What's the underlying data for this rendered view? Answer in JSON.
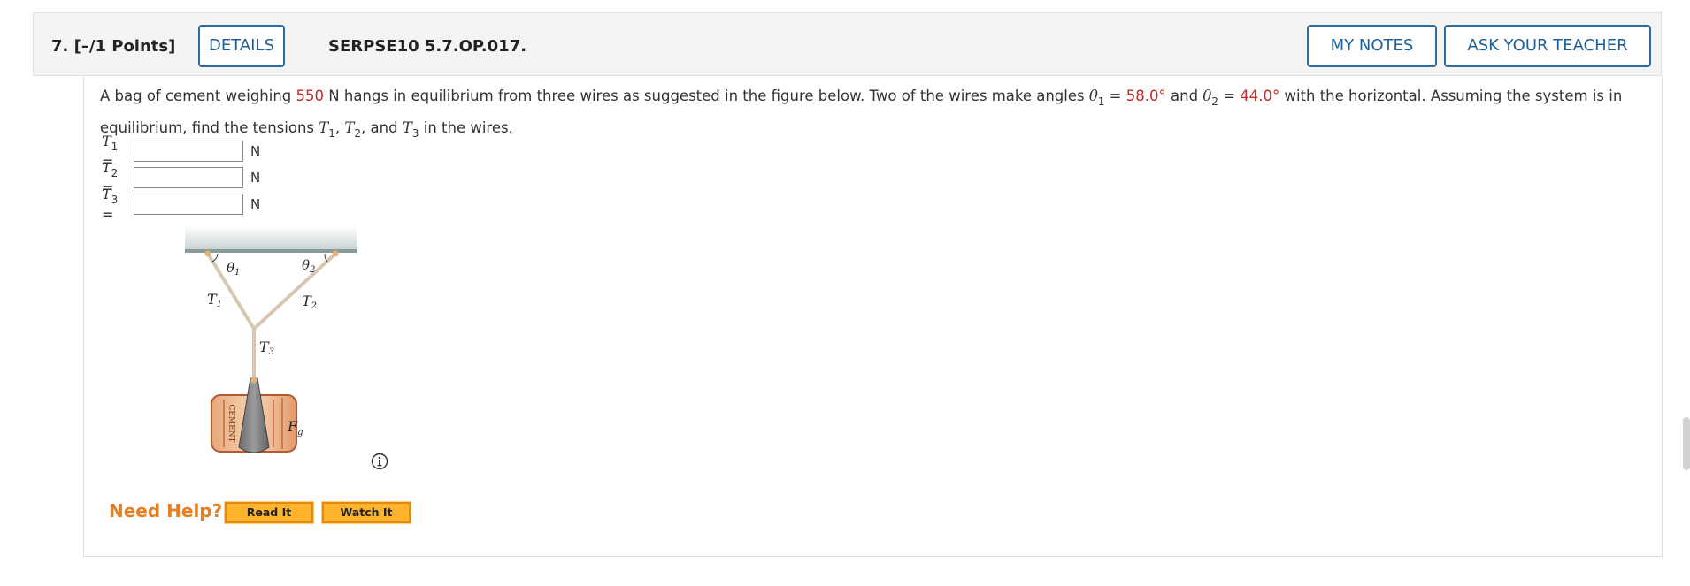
{
  "header": {
    "number": "7.",
    "points": "[–/1 Points]",
    "details_label": "DETAILS",
    "problem_code": "SERPSE10 5.7.OP.017.",
    "my_notes_label": "MY NOTES",
    "ask_teacher_label": "ASK YOUR TEACHER"
  },
  "question": {
    "t1": "A bag of cement weighing ",
    "weight": "550",
    "t2": " N hangs in equilibrium from three wires as suggested in the figure below. Two of the wires make angles ",
    "theta": "θ",
    "sub1": "1",
    "t3": " = ",
    "angle1": "58.0°",
    "t4": " and ",
    "sub2": "2",
    "t5": " = ",
    "angle2": "44.0°",
    "t6": " with the horizontal. Assuming the system is in equilibrium, find the tensions ",
    "T": "T",
    "sub3": "3",
    "comma": ", ",
    "and": ", and ",
    "t7": " in the wires."
  },
  "answers": [
    {
      "var": "T",
      "sub": "1",
      "eq": "=",
      "value": "",
      "unit": "N"
    },
    {
      "var": "T",
      "sub": "2",
      "eq": "=",
      "value": "",
      "unit": "N"
    },
    {
      "var": "T",
      "sub": "3",
      "eq": "=",
      "value": "",
      "unit": "N"
    }
  ],
  "figure": {
    "theta1": "θ1",
    "theta2": "θ2",
    "T1": "T1",
    "T2": "T2",
    "T3": "T3",
    "Fg": "Fg",
    "cement_label": "CEMENT"
  },
  "help": {
    "label": "Need Help?",
    "read_label": "Read It",
    "watch_label": "Watch It"
  },
  "colors": {
    "accent": "#1f5f96",
    "given_values": "#c62828",
    "help": "#e67e22",
    "help_button": "#ffb32c"
  },
  "icons": [
    "info-icon"
  ]
}
